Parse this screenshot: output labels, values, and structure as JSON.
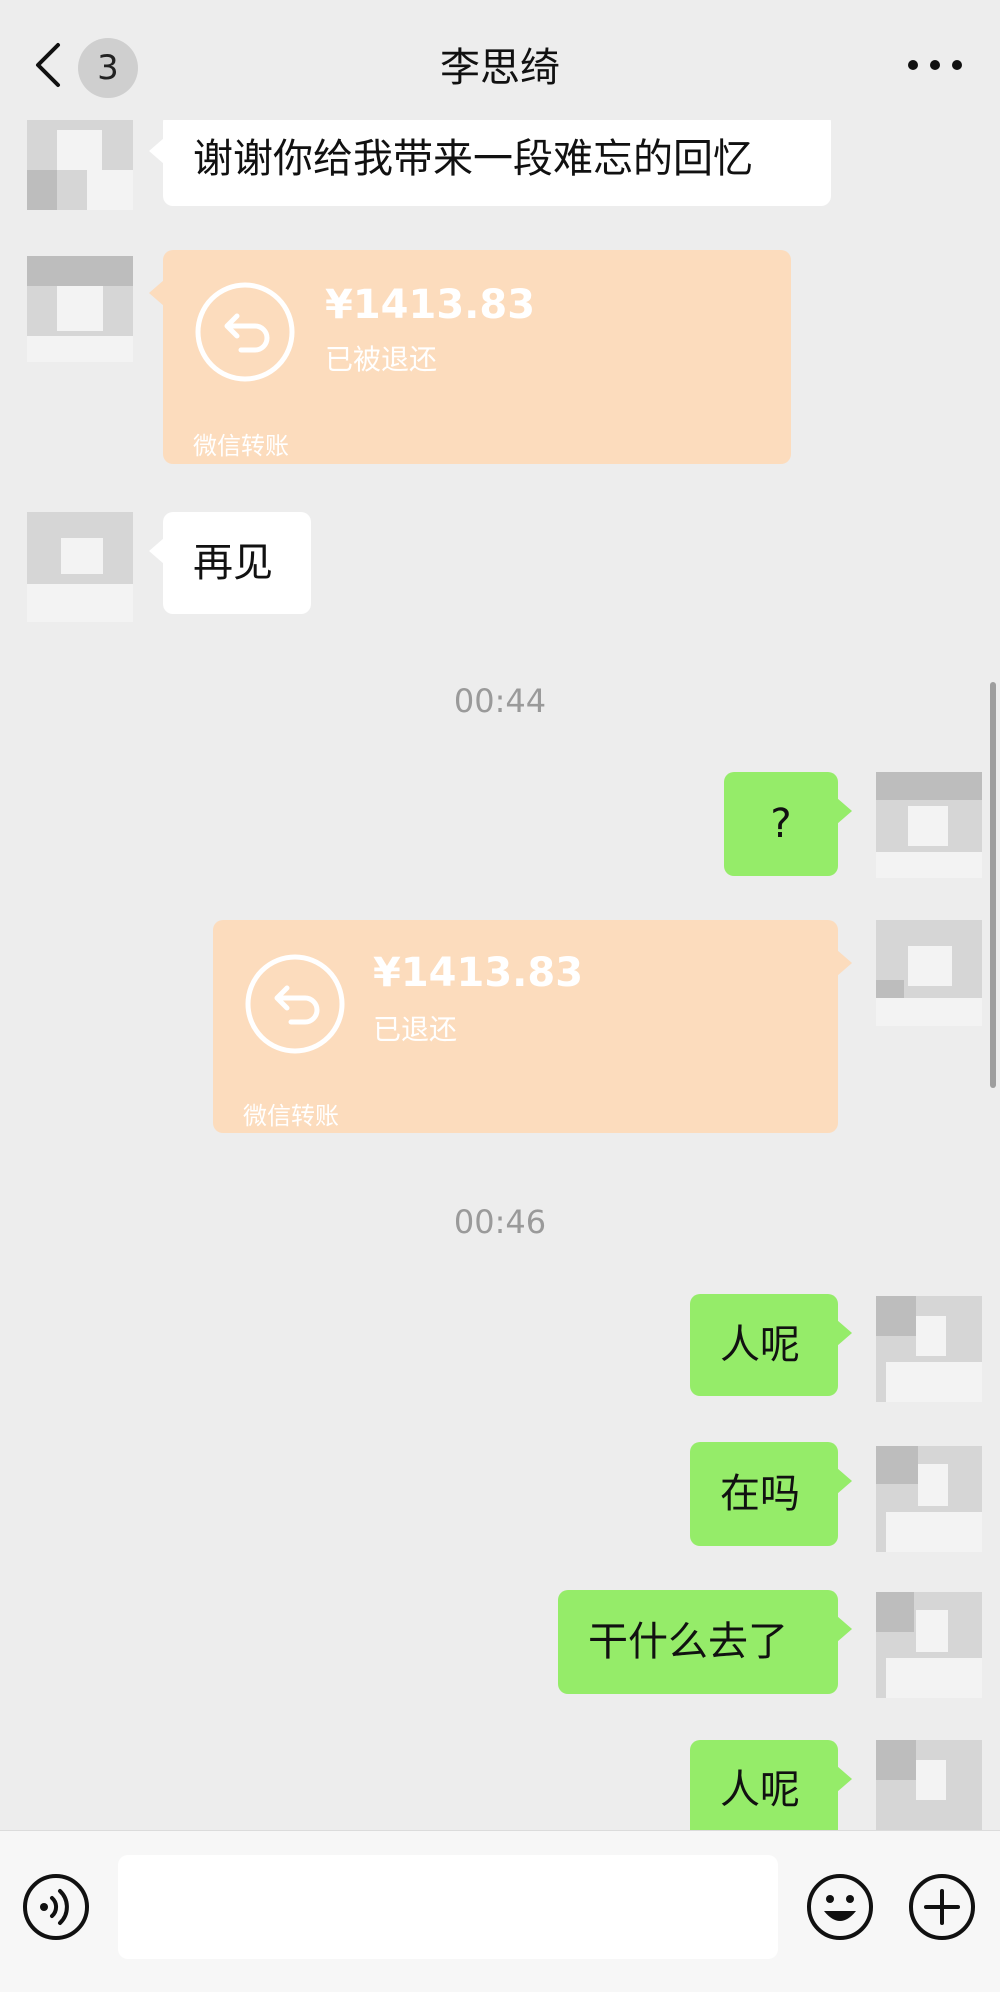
{
  "header": {
    "unread_count": "3",
    "title": "李思绮"
  },
  "messages": {
    "m1": "谢谢你给我带来一段难忘的回忆",
    "t1": {
      "amount": "¥1413.83",
      "status": "已被退还",
      "footer": "微信转账"
    },
    "m2": "再见",
    "time1": "00:44",
    "m3": "?",
    "t2": {
      "amount": "¥1413.83",
      "status": "已退还",
      "footer": "微信转账"
    },
    "time2": "00:46",
    "m4": "人呢",
    "m5": "在吗",
    "m6": "干什么去了",
    "m7": "人呢"
  },
  "colors": {
    "background": "#ededed",
    "bubble_in": "#ffffff",
    "bubble_out": "#95ec69",
    "transfer_card": "#fcdcbd"
  },
  "icons": [
    "back-icon",
    "more-icon",
    "voice-icon",
    "emoji-icon",
    "plus-icon",
    "refund-arrow-icon"
  ]
}
